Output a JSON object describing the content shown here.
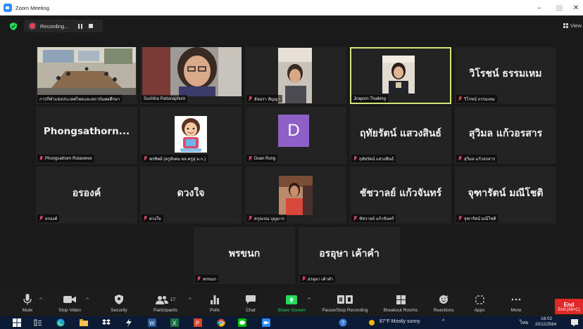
{
  "window": {
    "title": "Zoom Meeting",
    "controls": {
      "minimize": "–",
      "maximize": "⬜",
      "close": "✕"
    }
  },
  "recording": {
    "label": "Recording...",
    "dot_color": "#e0435a"
  },
  "view": {
    "label": "View"
  },
  "tiles": {
    "t1": {
      "name": "การกีฬาแห่งประเทศไทยและสถาบันพลศึกษา"
    },
    "t2": {
      "name": "Suchitra Pattanaphum"
    },
    "t3": {
      "name": "อัจฉรา สัญญา"
    },
    "t4": {
      "name": "Jiraporn Thaiking"
    },
    "t5": {
      "display": "วิโรชน์ ธรรมเหม",
      "name": "วิโรชน์ ธรรมเหม"
    },
    "t6": {
      "display": "Phongsathorn...",
      "name": "Phongsathorn Rotaseree"
    },
    "t7": {
      "name": "พรทิพย์ (ครูสังคม ผอ.ครูสุ ม.ก.)"
    },
    "t8": {
      "avatar_letter": "D",
      "name": "Duan Rung"
    },
    "t9": {
      "display": "ฤทัยรัตน์ แสวงสินธ์",
      "name": "ฤทัยรัตน์ แสวงสินธ์"
    },
    "t10": {
      "display": "สุวิมล แก้วอรสาร",
      "name": "สุวิมล แก้วอรสาร"
    },
    "t11": {
      "display": "อรองค์",
      "name": "อรองค์"
    },
    "t12": {
      "display": "ดวงใจ",
      "name": "ดวงใจ"
    },
    "t13": {
      "name": "ดรุณรณ บุญมาก"
    },
    "t14": {
      "display": "ชัชวาลย์ แก้วจันทร์",
      "name": "ชัชวาลย์ แก้วจันทร์"
    },
    "t15": {
      "display": "จุฑารัตน์ มณีโชติ",
      "name": "จุฑารัตน์ มณีโชติ"
    },
    "t16": {
      "display": "พรขนก",
      "name": "พรขนก"
    },
    "t17": {
      "display": "อรอุษา เค้าคำ",
      "name": "อรอุษา เค้าคำ"
    }
  },
  "toolbar": {
    "mute": "Mute",
    "stop_video": "Stop Video",
    "security": "Security",
    "participants": "Participants",
    "participants_count": "17",
    "polls": "Polls",
    "chat": "Chat",
    "share_screen": "Share Screen",
    "pause_recording": "Pause/Stop Recording",
    "breakout_rooms": "Breakout Rooms",
    "reactions": "Reactions",
    "apps": "Apps",
    "more": "More",
    "end": "End",
    "end_hint": "End (Alt+C)",
    "share_color": "#23d959",
    "end_color": "#e02828"
  },
  "taskbar": {
    "weather": "87°F  Mostly sunny",
    "language": "ไทย",
    "time": "16:02",
    "date": "20/12/2564"
  }
}
